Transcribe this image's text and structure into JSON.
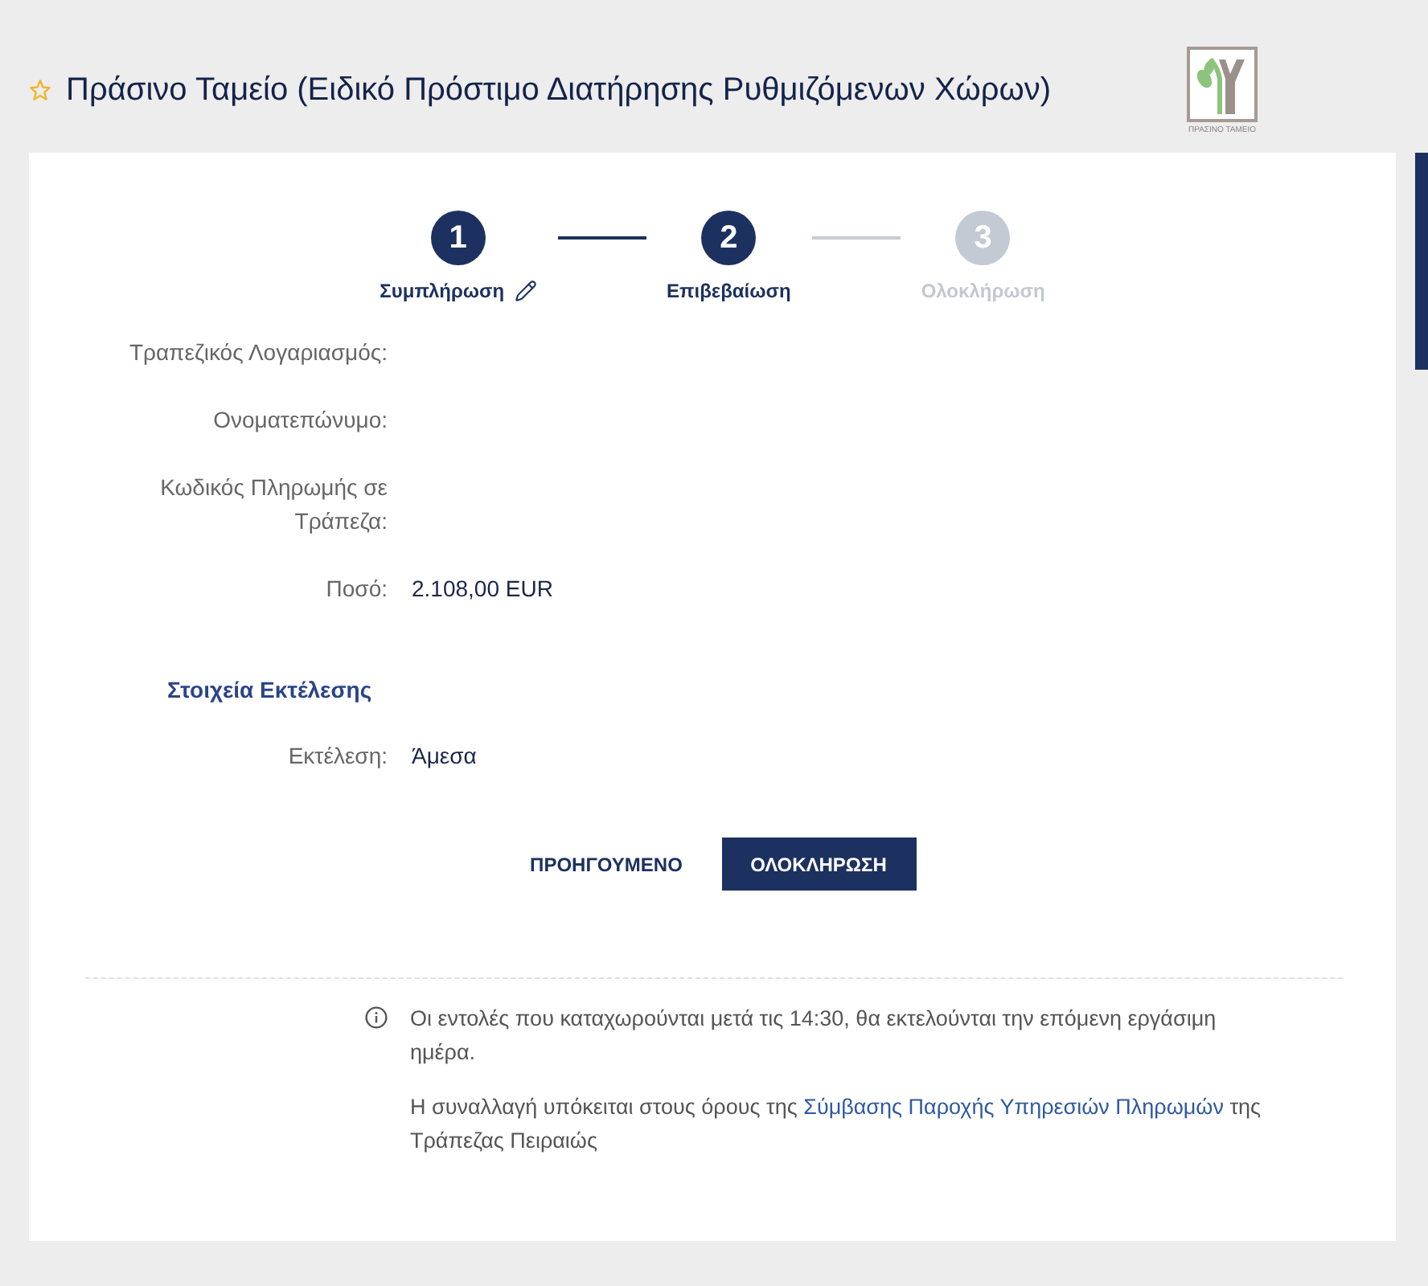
{
  "header": {
    "starred": false,
    "title": "Πράσινο Ταμείο (Ειδικό Πρόστιμο Διατήρησης Ρυθμιζόμενων Χώρων)",
    "logo_caption": "ΠΡΑΣΙΝΟ ΤΑΜΕΙΟ"
  },
  "stepper": [
    {
      "number": "1",
      "label": "Συμπλήρωση",
      "active": true,
      "done": true
    },
    {
      "number": "2",
      "label": "Επιβεβαίωση",
      "active": true,
      "done": false
    },
    {
      "number": "3",
      "label": "Ολοκλήρωση",
      "active": false,
      "done": false
    }
  ],
  "fields": [
    {
      "label": "Τραπεζικός Λογαριασμός:"
    },
    {
      "label": "Ονοματεπώνυμο:"
    },
    {
      "label": "Κωδικός Πληρωμής σε Τράπεζα:"
    },
    {
      "label": "Ποσό:",
      "value": "2.108,00 EUR"
    }
  ],
  "execution": {
    "title": "Στοιχεία Εκτέλεσης",
    "fields": [
      {
        "label": "Εκτέλεση:",
        "value": "Άμεσα"
      }
    ]
  },
  "buttons": [
    {
      "label": "ΠΡΟΗΓΟΥΜΕΝΟ",
      "kind": "text"
    },
    {
      "label": "ΟΛΟΚΛΗΡΩΣΗ",
      "kind": "primary"
    }
  ],
  "notes": [
    {
      "kind": "info",
      "text": "Οι εντολές που καταχωρούνται μετά τις 14:30, θα εκτελούνται την επόμενη εργάσιμη ημέρα."
    },
    {
      "kind": "terms",
      "before": "Η συναλλαγή υπόκειται στους όρους της ",
      "link": "Σύμβασης Παροχής Υπηρεσιών Πληρωμών",
      "after": " της Τράπεζας Πειραιώς"
    }
  ]
}
